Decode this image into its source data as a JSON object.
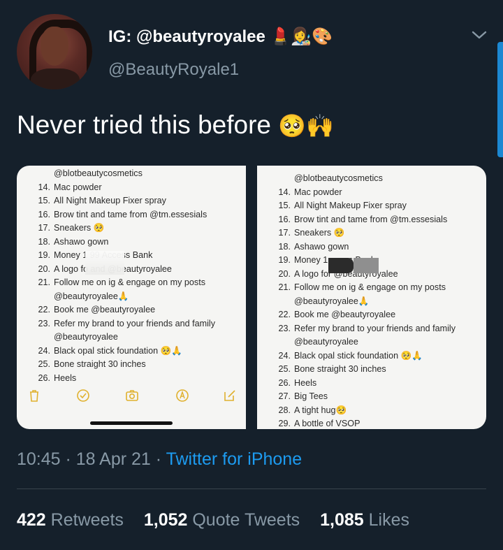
{
  "author": {
    "display_name": "IG: @beautyroyalee",
    "display_name_emoji": "💄👩‍🎨🎨",
    "handle": "@BeautyRoyale1"
  },
  "tweet": {
    "text": "Never tried this before",
    "emoji": "🥺🙌"
  },
  "media": {
    "left_lines": [
      {
        "n": "",
        "t": "@blotbeautycosmetics",
        "cont": true
      },
      {
        "n": "14.",
        "t": "Mac powder"
      },
      {
        "n": "15.",
        "t": "All Night Makeup Fixer spray"
      },
      {
        "n": "16.",
        "t": "Brow tint and tame from @tm.essesials"
      },
      {
        "n": "17.",
        "t": "Sneakers 🥺"
      },
      {
        "n": "18.",
        "t": "Ashawo gown"
      },
      {
        "n": "19.",
        "t": "Money 1          99 Access Bank"
      },
      {
        "n": "20.",
        "t": "A logo fo          and @beautyroyalee"
      },
      {
        "n": "21.",
        "t": "Follow me on ig & engage on my posts"
      },
      {
        "n": "",
        "t": "@beautyroyalee🙏",
        "cont": true
      },
      {
        "n": "22.",
        "t": "Book me @beautyroyalee"
      },
      {
        "n": "23.",
        "t": "Refer my brand to your friends and family"
      },
      {
        "n": "",
        "t": "@beautyroyalee",
        "cont": true
      },
      {
        "n": "24.",
        "t": "Black opal stick foundation 🥺🙏"
      },
      {
        "n": "25.",
        "t": "Bone straight 30 inches"
      },
      {
        "n": "26.",
        "t": "Heels"
      }
    ],
    "right_lines": [
      {
        "n": "",
        "t": "@blotbeautycosmetics",
        "cont": true
      },
      {
        "n": "14.",
        "t": "Mac powder"
      },
      {
        "n": "15.",
        "t": "All Night Makeup Fixer spray"
      },
      {
        "n": "16.",
        "t": "Brow tint and tame from @tm.essesials"
      },
      {
        "n": "17.",
        "t": "Sneakers 🥺"
      },
      {
        "n": "18.",
        "t": "Ashawo gown"
      },
      {
        "n": "19.",
        "t": "Money 1               ccess Bank"
      },
      {
        "n": "20.",
        "t": "A logo for                     @beautyroyalee"
      },
      {
        "n": "21.",
        "t": "Follow me on ig & engage on my posts"
      },
      {
        "n": "",
        "t": "@beautyroyalee🙏",
        "cont": true
      },
      {
        "n": "22.",
        "t": "Book me @beautyroyalee"
      },
      {
        "n": "23.",
        "t": "Refer my brand to your friends and family"
      },
      {
        "n": "",
        "t": "@beautyroyalee",
        "cont": true
      },
      {
        "n": "24.",
        "t": "Black opal stick foundation 🥺🙏"
      },
      {
        "n": "25.",
        "t": "Bone straight 30 inches"
      },
      {
        "n": "26.",
        "t": "Heels"
      },
      {
        "n": "27.",
        "t": "Big Tees"
      },
      {
        "n": "28.",
        "t": "A tight hug🥺"
      },
      {
        "n": "29.",
        "t": "A bottle of VSOP"
      }
    ]
  },
  "meta": {
    "time": "10:45",
    "sep1": " · ",
    "date": "18 Apr 21",
    "sep2": " · ",
    "source": "Twitter for iPhone"
  },
  "stats": {
    "retweets_count": "422",
    "retweets_label": "Retweets",
    "quotes_count": "1,052",
    "quotes_label": "Quote Tweets",
    "likes_count": "1,085",
    "likes_label": "Likes"
  },
  "colors": {
    "background": "#15202b",
    "secondary_text": "#8899a6",
    "accent": "#1d9bf0",
    "divider": "#38444d"
  }
}
